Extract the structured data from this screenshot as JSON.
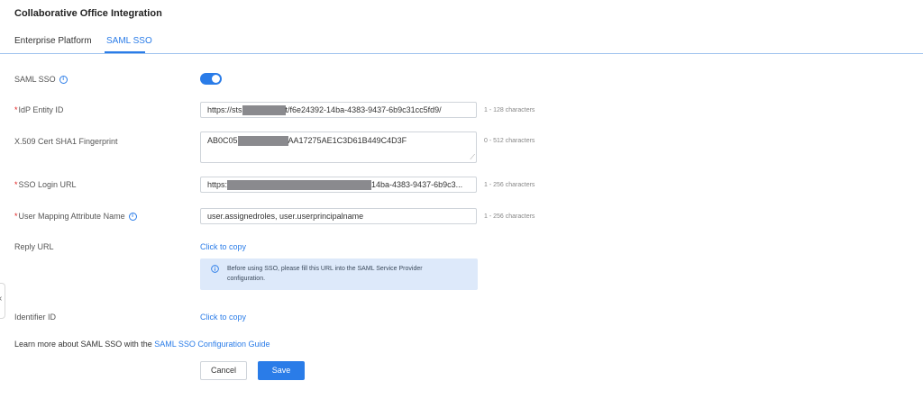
{
  "page": {
    "title": "Collaborative Office Integration"
  },
  "tabs": [
    {
      "label": "Enterprise Platform",
      "active": false
    },
    {
      "label": "SAML SSO",
      "active": true
    }
  ],
  "form": {
    "saml_sso": {
      "label": "SAML SSO",
      "enabled": true
    },
    "idp_entity_id": {
      "label": "IdP Entity ID",
      "required": true,
      "value_prefix": "https://sts",
      "value_suffix": "t/f6e24392-14ba-4383-9437-6b9c31cc5fd9/",
      "hint": "1 - 128 characters"
    },
    "x509_fingerprint": {
      "label": "X.509 Cert SHA1 Fingerprint",
      "required": false,
      "value_prefix": "AB0C05",
      "value_suffix": "AA17275AE1C3D61B449C4D3F",
      "hint": "0 - 512 characters"
    },
    "sso_login_url": {
      "label": "SSO Login URL",
      "required": true,
      "value_prefix": "https:",
      "value_suffix": "14ba-4383-9437-6b9c3...",
      "hint": "1 - 256 characters"
    },
    "user_mapping": {
      "label": "User Mapping Attribute Name",
      "required": true,
      "value": "user.assignedroles, user.userprincipalname",
      "hint": "1 - 256 characters"
    },
    "reply_url": {
      "label": "Reply URL",
      "link": "Click to copy",
      "notice": "Before using SSO, please fill this URL into the SAML Service Provider configuration."
    },
    "identifier_id": {
      "label": "Identifier ID",
      "link": "Click to copy"
    }
  },
  "footer": {
    "learn_more_text": "Learn more about SAML SSO with the ",
    "guide_link": "SAML SSO Configuration Guide"
  },
  "buttons": {
    "cancel": "Cancel",
    "save": "Save"
  },
  "icons": {
    "info": "info-circle-icon",
    "collapse": "chevron-left-icon",
    "resize": "textarea-resize-icon"
  },
  "colors": {
    "accent": "#2a7ce8",
    "required": "#e02020",
    "notice_bg": "#dde9fa",
    "redaction": "#8a8a8e"
  }
}
